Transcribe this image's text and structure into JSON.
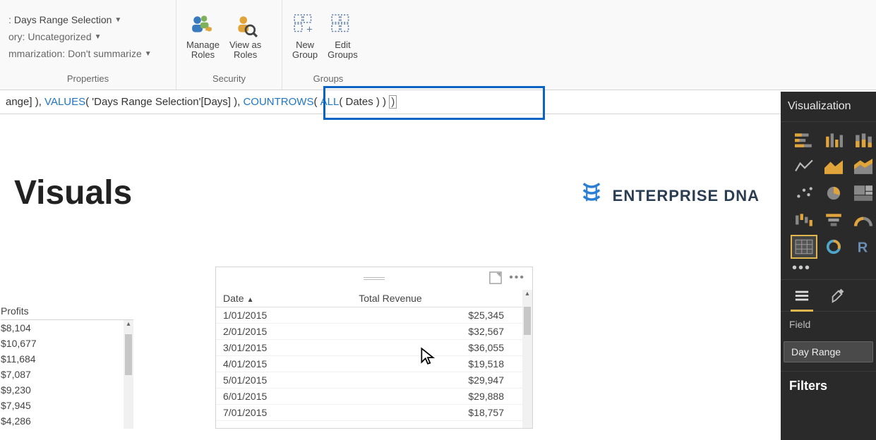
{
  "ribbon": {
    "properties": {
      "group_label": "Properties",
      "row1_prefix": ": ",
      "row1_value": "Days Range Selection",
      "row2_prefix": "ory: ",
      "row2_value": "Uncategorized",
      "row3_prefix": "mmarization: ",
      "row3_value": "Don't summarize"
    },
    "security": {
      "group_label": "Security",
      "manage": "Manage\nRoles",
      "viewas": "View as\nRoles"
    },
    "groups": {
      "group_label": "Groups",
      "new": "New\nGroup",
      "edit": "Edit\nGroups"
    }
  },
  "formula": {
    "seg1": "ange] ), ",
    "seg2": "VALUES",
    "seg3": "( 'Days Range Selection'[Days] )",
    "seg4": ", ",
    "seg5": "COUNTROWS",
    "seg6": "( ",
    "seg7": "ALL",
    "seg8": "( Dates ) ) ",
    "seg9": ")"
  },
  "canvas": {
    "title": "Visuals",
    "logo_text": "ENTERPRISE DNA",
    "profits": {
      "header": "Profits",
      "rows": [
        "$8,104",
        "$10,677",
        "$11,684",
        "$7,087",
        "$9,230",
        "$7,945",
        "$4,286"
      ]
    },
    "matrix": {
      "col_date": "Date",
      "col_rev": "Total Revenue",
      "rows": [
        {
          "date": "1/01/2015",
          "rev": "$25,345"
        },
        {
          "date": "2/01/2015",
          "rev": "$32,567"
        },
        {
          "date": "3/01/2015",
          "rev": "$36,055"
        },
        {
          "date": "4/01/2015",
          "rev": "$19,518"
        },
        {
          "date": "5/01/2015",
          "rev": "$29,947"
        },
        {
          "date": "6/01/2015",
          "rev": "$29,888"
        },
        {
          "date": "7/01/2015",
          "rev": "$18,757"
        }
      ]
    }
  },
  "viz_pane": {
    "title": "Visualization",
    "field_label": "Field",
    "field_chip": "Day Range",
    "filters_label": "Filters",
    "icons": [
      "stacked-bar",
      "clustered-column",
      "stacked-column",
      "line",
      "area",
      "stacked-area",
      "scatter",
      "pie",
      "treemap",
      "waterfall",
      "funnel",
      "gauge",
      "table",
      "donut",
      "r-script"
    ]
  }
}
